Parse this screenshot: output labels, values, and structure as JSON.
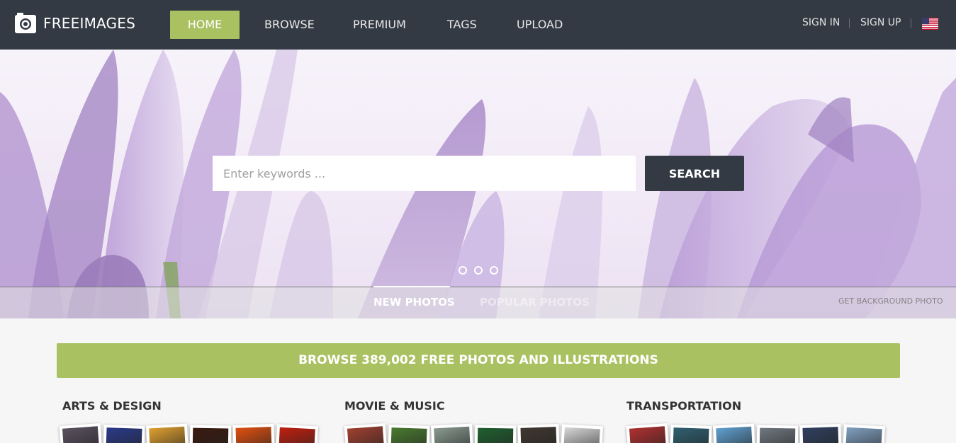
{
  "nav": {
    "logo_text": "FREEIMAGES",
    "items": [
      {
        "label": "HOME"
      },
      {
        "label": "BROWSE"
      },
      {
        "label": "PREMIUM"
      },
      {
        "label": "TAGS"
      },
      {
        "label": "UPLOAD"
      }
    ],
    "sign_in": "SIGN IN",
    "sign_up": "SIGN UP",
    "language_icon": "us-flag-icon"
  },
  "hero": {
    "search_placeholder": "Enter keywords ...",
    "search_value": "",
    "search_button": "SEARCH",
    "carousel_dots": 3,
    "tabs": [
      {
        "label": "NEW PHOTOS",
        "active": true
      },
      {
        "label": "POPULAR PHOTOS",
        "active": false
      }
    ],
    "background_credit": "GET BACKGROUND PHOTO"
  },
  "browse_bar": "BROWSE 389,002 FREE PHOTOS AND ILLUSTRATIONS",
  "categories": [
    {
      "title": "ARTS & DESIGN",
      "thumb_colors": [
        "#5a5260",
        "#2a3a8a",
        "#e0a030",
        "#3a1a10",
        "#e05010",
        "#c02010"
      ]
    },
    {
      "title": "MOVIE & MUSIC",
      "thumb_colors": [
        "#a04030",
        "#4a7a30",
        "#8a9a90",
        "#206030",
        "#403830",
        "#d8d8d8"
      ]
    },
    {
      "title": "TRANSPORTATION",
      "thumb_colors": [
        "#b03030",
        "#306070",
        "#60a0d0",
        "#707880",
        "#304060",
        "#80a0c0"
      ]
    }
  ],
  "colors": {
    "nav_bg": "#333a43",
    "accent": "#a9c161"
  }
}
